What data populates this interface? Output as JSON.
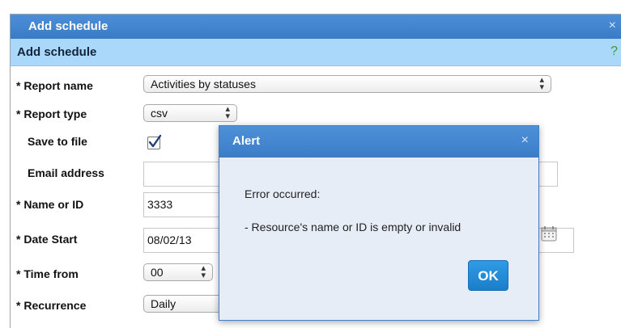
{
  "dialog": {
    "title": "Add schedule",
    "close_glyph": "×",
    "section_title": "Add schedule",
    "help_glyph": "?"
  },
  "form": {
    "report_name_label": "* Report name",
    "report_name_value": "Activities by statuses",
    "report_type_label": "* Report type",
    "report_type_value": "csv",
    "save_to_file_label": "Save to file",
    "save_to_file_checked": true,
    "email_label": "Email address",
    "email_value": "",
    "name_or_id_label": "* Name or ID",
    "name_or_id_value": "3333",
    "date_start_label": "* Date Start",
    "date_start_value": "08/02/13",
    "time_from_label": "* Time from",
    "time_from_value": "00",
    "recurrence_label": "* Recurrence",
    "recurrence_value": "Daily"
  },
  "alert": {
    "title": "Alert",
    "close_glyph": "×",
    "line1": "Error occurred:",
    "line2": "- Resource's name or ID is empty or invalid",
    "ok_label": "OK"
  },
  "icons": {
    "close": "close-icon",
    "help": "help-icon",
    "checkmark": "checkmark-icon",
    "calendar": "calendar-icon",
    "select_arrows": "select-arrows-icon"
  },
  "colors": {
    "titlebar": "#3a7bc6",
    "section_header": "#a9d8fb",
    "alert_body": "#e6edf6",
    "ok_button": "#1b7ec9",
    "help": "#3c9a3c"
  }
}
